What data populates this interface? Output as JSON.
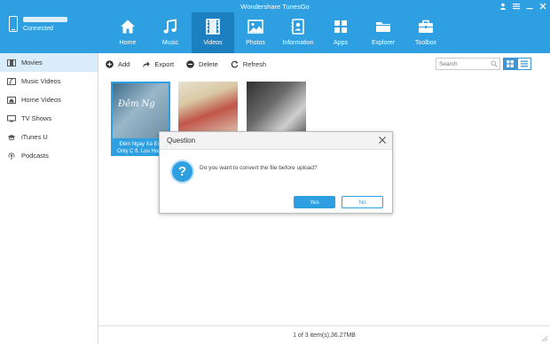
{
  "app": {
    "title": "Wondershare TunesGo"
  },
  "window_controls": [
    "user-icon",
    "menu-icon",
    "minimize-icon",
    "close-icon"
  ],
  "device": {
    "status": "Connected"
  },
  "nav": [
    {
      "label": "Home",
      "icon": "home-icon"
    },
    {
      "label": "Music",
      "icon": "music-icon"
    },
    {
      "label": "Videos",
      "icon": "film-icon",
      "active": true
    },
    {
      "label": "Photos",
      "icon": "photo-icon"
    },
    {
      "label": "Information",
      "icon": "contacts-icon"
    },
    {
      "label": "Apps",
      "icon": "apps-icon"
    },
    {
      "label": "Explorer",
      "icon": "folder-icon"
    },
    {
      "label": "Toolbox",
      "icon": "toolbox-icon"
    }
  ],
  "sidebar": {
    "items": [
      {
        "label": "Movies",
        "icon": "movie-icon",
        "active": true
      },
      {
        "label": "Music Videos",
        "icon": "music-video-icon"
      },
      {
        "label": "Home Videos",
        "icon": "home-video-icon"
      },
      {
        "label": "TV Shows",
        "icon": "tv-icon"
      },
      {
        "label": "iTunes U",
        "icon": "graduation-cap-icon"
      },
      {
        "label": "Podcasts",
        "icon": "podcast-icon"
      }
    ]
  },
  "toolbar": {
    "add_label": "Add",
    "export_label": "Export",
    "delete_label": "Delete",
    "refresh_label": "Refresh",
    "search_placeholder": "Search"
  },
  "videos": [
    {
      "caption_line1": "Đêm Ngày Xa Em",
      "caption_line2": "Only C ft. Lou Hoàn",
      "overlay_text": "Đêm Ng",
      "selected": true
    },
    {
      "caption_line1": "",
      "caption_line2": ""
    },
    {
      "caption_line1": "",
      "caption_line2": ""
    }
  ],
  "status": {
    "text": "1 of 3 item(s),36.27MB"
  },
  "dialog": {
    "title": "Question",
    "message": "Do you want to convert the file before upload?",
    "yes_label": "Yes",
    "no_label": "No"
  },
  "colors": {
    "accent": "#2e9fe0",
    "accent_dark": "#1c7fc0",
    "selection": "#d8ecf9"
  }
}
